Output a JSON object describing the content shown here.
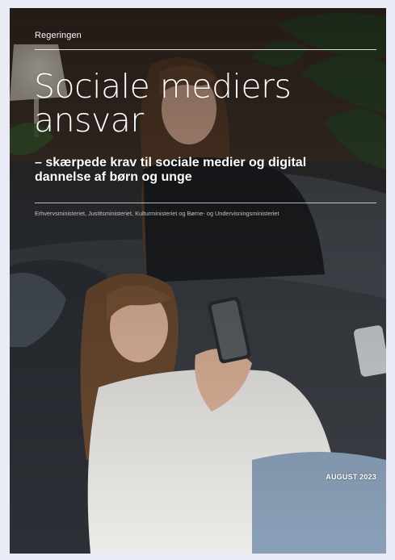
{
  "cover": {
    "publisher": "Regeringen",
    "title_line1": "Sociale mediers",
    "title_line2": "ansvar",
    "subtitle_line1": "– skærpede krav til sociale medier og digital",
    "subtitle_line2": "dannelse af børn og unge",
    "ministries": "Erhvervsministeriet, Justitsministeriet, Kulturministeriet og Børne- og Undervisningsministeriet",
    "date": "AUGUST 2023"
  },
  "colors": {
    "page_background": "#e9ecf7",
    "text": "#ffffff"
  }
}
